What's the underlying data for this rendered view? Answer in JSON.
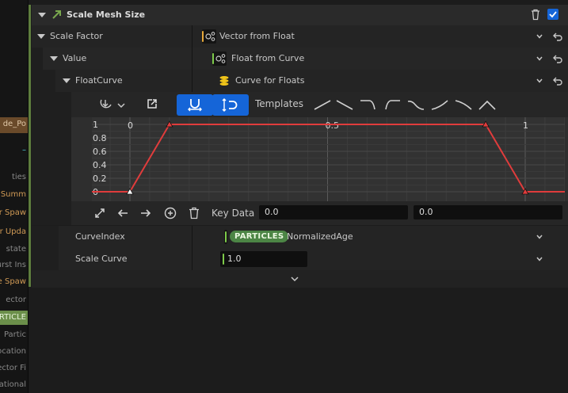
{
  "left_panel": {
    "items": [
      "de_Po",
      "",
      "–",
      "ties",
      "Summ",
      "r Spaw",
      "r Upda",
      "state",
      "urst Ins",
      "e Spaw",
      "ector",
      "RTICLE",
      "Partic",
      "ocation",
      "ector Fi",
      "otational"
    ]
  },
  "header": {
    "title": "Scale Mesh Size",
    "enabled": true
  },
  "rows": {
    "scale_factor": {
      "label": "Scale Factor",
      "value": "Vector from Float"
    },
    "value": {
      "label": "Value",
      "value": "Float from Curve"
    },
    "float_curve": {
      "label": "FloatCurve",
      "value": "Curve for Floats"
    },
    "curve_index": {
      "label": "CurveIndex",
      "badge": "PARTICLES",
      "value": "NormalizedAge"
    },
    "scale_curve": {
      "label": "Scale Curve",
      "value": "1.0"
    }
  },
  "curve_editor": {
    "templates_label": "Templates",
    "templates": [
      "linear-up",
      "linear-down",
      "ease-out",
      "ease-in",
      "smooth-step-down",
      "smooth-up",
      "smooth-down",
      "bell"
    ],
    "y_ticks": [
      "1",
      "0.8",
      "0.6",
      "0.4",
      "0.2",
      "0"
    ],
    "x_ticks": [
      "0",
      "0.5",
      "1"
    ],
    "keys": [
      {
        "time": 0.0,
        "value": 0.0
      },
      {
        "time": 0.1,
        "value": 1.0
      },
      {
        "time": 0.9,
        "value": 1.0
      },
      {
        "time": 1.0,
        "value": 0.0
      }
    ],
    "curve_color": "#e03c3c",
    "key_data_label": "Key Data",
    "key_time": "0.0",
    "key_value": "0.0"
  },
  "colors": {
    "accent_blue": "#1565d8",
    "green_accent": "#5e7d3e",
    "vector_type": "#e8a93a",
    "float_type": "#7ecb4a",
    "curve_type": "#f0c419"
  }
}
